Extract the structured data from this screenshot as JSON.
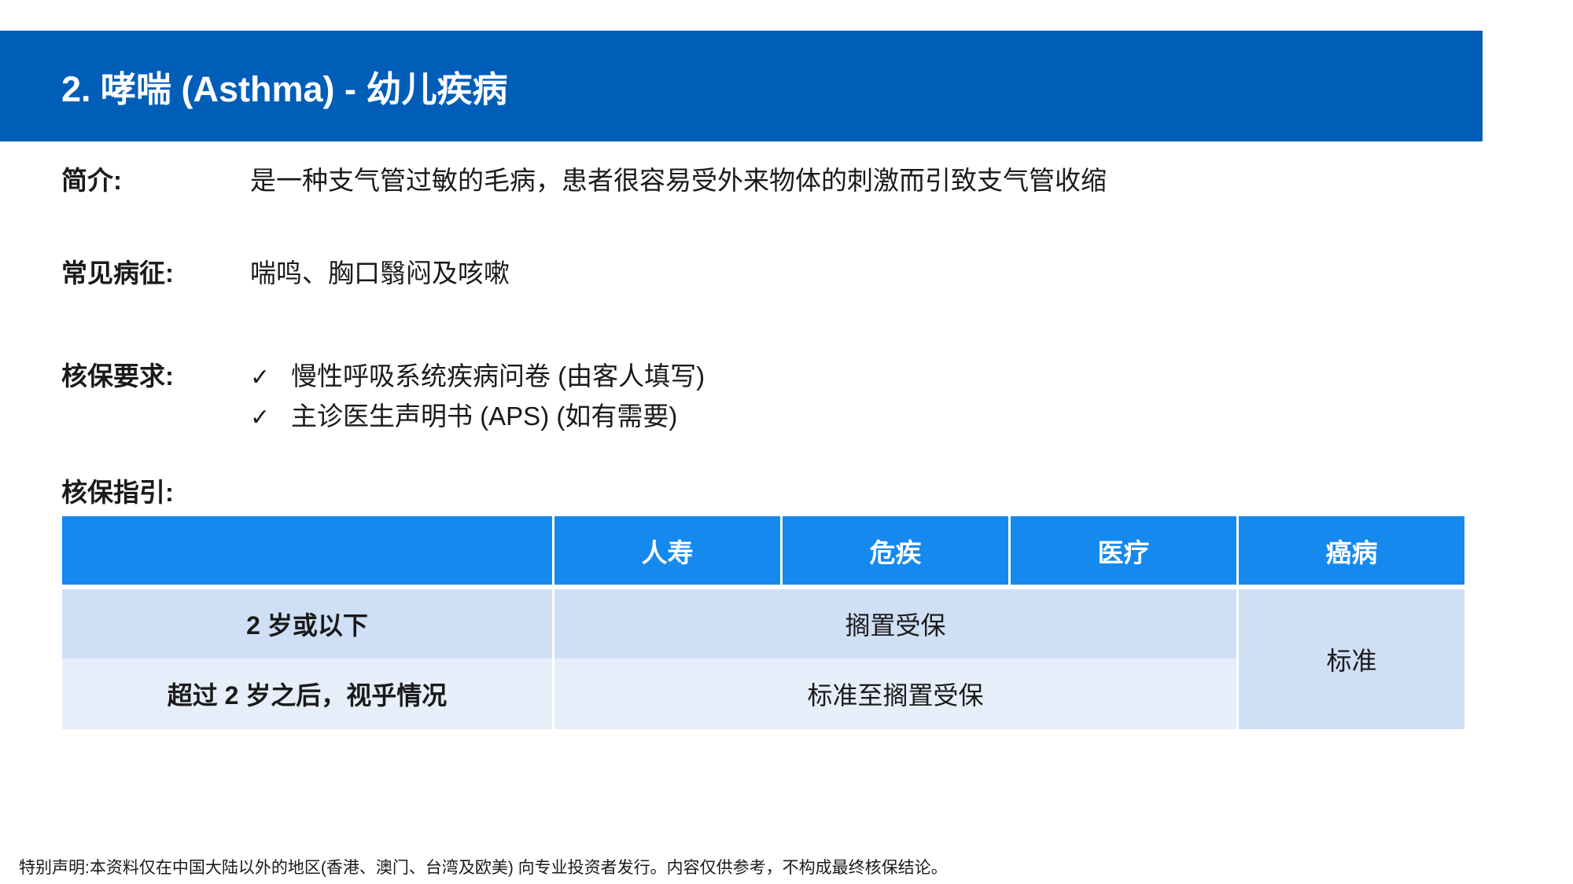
{
  "header": {
    "title": "2. 哮喘 (Asthma) - 幼儿疾病",
    "bar_color": "#005eb8"
  },
  "intro": {
    "label": "简介:",
    "value": "是一种支气管过敏的毛病，患者很容易受外来物体的刺激而引致支气管收缩"
  },
  "symptoms": {
    "label": "常见病征:",
    "value": "喘鸣、胸口翳闷及咳嗽"
  },
  "requirements": {
    "label": "核保要求:",
    "check_icon": "check-icon",
    "check_glyph": "✓",
    "items": [
      "慢性呼吸系统疾病问卷 (由客人填写)",
      "主诊医生声明书 (APS) (如有需要)"
    ]
  },
  "guide": {
    "label": "核保指引:",
    "columns": [
      "",
      "人寿",
      "危疾",
      "医疗",
      "癌病"
    ],
    "rows": [
      {
        "condition": "2 岁或以下",
        "life_ci_medical": "搁置受保"
      },
      {
        "condition": "超过 2 岁之后，视乎情况",
        "life_ci_medical": "标准至搁置受保"
      }
    ],
    "cancer": "标准",
    "colors": {
      "header": "#1589ee",
      "row_dark": "#cfdff5",
      "row_light": "#e6eefa"
    }
  },
  "footer": "特别声明:本资料仅在中国大陆以外的地区(香港、澳门、台湾及欧美) 向专业投资者发行。内容仅供参考，不构成最终核保结论。"
}
